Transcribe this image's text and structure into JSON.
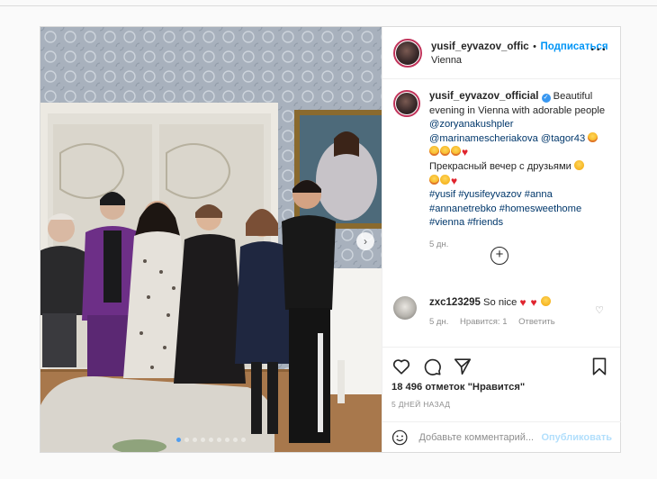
{
  "header": {
    "username": "yusif_eyvazov_offic",
    "separator": "•",
    "follow_label": "Подписаться",
    "location": "Vienna",
    "more_icon": "more-horizontal-icon"
  },
  "caption": {
    "username": "yusif_eyvazov_official",
    "verified_icon": "verified-badge-icon",
    "text_1": "Beautiful evening in Vienna with adorable people",
    "mention_1": "@zoryanakushpler",
    "mention_2": "@marinamescheriakova",
    "mention_3": "@tagor43",
    "text_2": "Прекрасный вечер с друзьями",
    "hashtags": [
      "#yusif",
      "#yusifeyvazov",
      "#anna",
      "#annanetrebko",
      "#homesweethome",
      "#vienna",
      "#friends"
    ],
    "age": "5 дн."
  },
  "load_more_icon": "plus-circle-icon",
  "comment": {
    "username": "zxc123295",
    "text": "So nice",
    "age": "5 дн.",
    "likes_label": "Нравится: 1",
    "reply_label": "Ответить",
    "like_icon": "heart-outline-icon"
  },
  "actions": {
    "icons": [
      "heart-icon",
      "comment-icon",
      "share-icon",
      "bookmark-icon"
    ],
    "likes_text": "18 496 отметок \"Нравится\"",
    "date_text": "5 ДНЕЙ НАЗАД"
  },
  "add_comment": {
    "placeholder": "Добавьте комментарий...",
    "publish_label": "Опубликовать",
    "emoji_icon": "smiley-icon"
  },
  "carousel": {
    "slide_count": 9,
    "active_index": 0,
    "next_icon": "chevron-right-icon"
  },
  "colors": {
    "link": "#00376b",
    "follow": "#0095f6",
    "publish_disabled": "#b2dffc",
    "heart": "#e0242e"
  }
}
